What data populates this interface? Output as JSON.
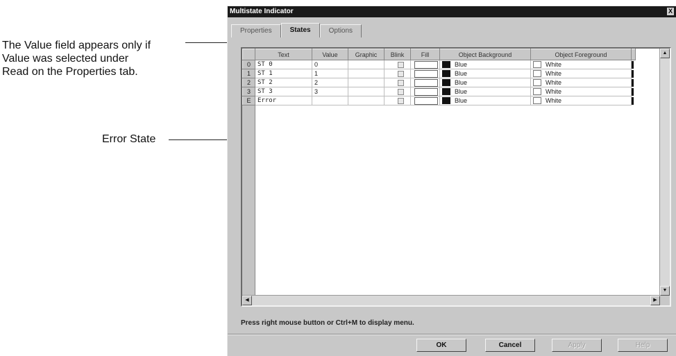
{
  "callouts": {
    "value_field_note": "The Value field appears only if\nValue was selected under\nRead on the Properties tab.",
    "error_state_note": "Error State"
  },
  "dialog": {
    "title": "Multistate Indicator",
    "close_glyph": "X",
    "tabs": [
      {
        "label": "Properties",
        "active": false
      },
      {
        "label": "States",
        "active": true
      },
      {
        "label": "Options",
        "active": false
      }
    ],
    "grid": {
      "columns": [
        "Text",
        "Value",
        "Graphic",
        "Blink",
        "Fill",
        "Object Background",
        "Object Foreground"
      ],
      "rows": [
        {
          "id": "0",
          "text": "ST 0",
          "value": "0",
          "graphic": "",
          "blink": false,
          "background": "Blue",
          "foreground": "White"
        },
        {
          "id": "1",
          "text": "ST 1",
          "value": "1",
          "graphic": "",
          "blink": false,
          "background": "Blue",
          "foreground": "White"
        },
        {
          "id": "2",
          "text": "ST 2",
          "value": "2",
          "graphic": "",
          "blink": false,
          "background": "Blue",
          "foreground": "White"
        },
        {
          "id": "3",
          "text": "ST 3",
          "value": "3",
          "graphic": "",
          "blink": false,
          "background": "Blue",
          "foreground": "White"
        },
        {
          "id": "E",
          "text": "Error",
          "value": "",
          "graphic": "",
          "blink": false,
          "background": "Blue",
          "foreground": "White"
        }
      ]
    },
    "status_text": "Press right mouse button or Ctrl+M to display menu.",
    "buttons": {
      "ok": "OK",
      "cancel": "Cancel",
      "apply": "Apply",
      "help": "Help"
    }
  },
  "icons": {
    "scroll_up": "scroll-up-arrow-icon",
    "scroll_down": "scroll-down-arrow-icon",
    "scroll_left": "scroll-left-arrow-icon",
    "scroll_right": "scroll-right-arrow-icon"
  },
  "colors": {
    "titlebar": "#1a1a1a",
    "dialog_face": "#c8c8c8",
    "background_swatch": "#111111",
    "foreground_swatch": "#ffffff"
  }
}
